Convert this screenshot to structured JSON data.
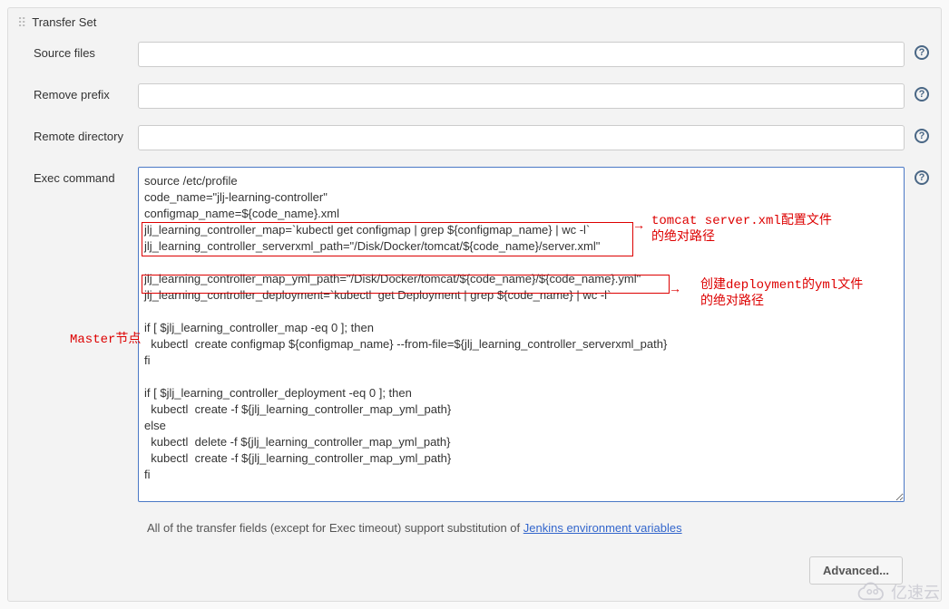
{
  "panel": {
    "title": "Transfer Set"
  },
  "fields": {
    "source_files": {
      "label": "Source files",
      "value": ""
    },
    "remove_prefix": {
      "label": "Remove prefix",
      "value": ""
    },
    "remote_directory": {
      "label": "Remote directory",
      "value": ""
    },
    "exec_command": {
      "label": "Exec command",
      "value": "source /etc/profile\ncode_name=\"jlj-learning-controller\"\nconfigmap_name=${code_name}.xml\njlj_learning_controller_map=`kubectl get configmap | grep ${configmap_name} | wc -l`\njlj_learning_controller_serverxml_path=\"/Disk/Docker/tomcat/${code_name}/server.xml\"\n\njlj_learning_controller_map_yml_path=\"/Disk/Docker/tomcat/${code_name}/${code_name}.yml\"\njlj_learning_controller_deployment=`kubectl  get Deployment | grep ${code_name} | wc -l`\n\nif [ $jlj_learning_controller_map -eq 0 ]; then\n  kubectl  create configmap ${configmap_name} --from-file=${jlj_learning_controller_serverxml_path}\nfi\n\nif [ $jlj_learning_controller_deployment -eq 0 ]; then\n  kubectl  create -f ${jlj_learning_controller_map_yml_path}\nelse\n  kubectl  delete -f ${jlj_learning_controller_map_yml_path}\n  kubectl  create -f ${jlj_learning_controller_map_yml_path}\nfi"
    }
  },
  "helper": {
    "prefix": "All of the transfer fields (except for Exec timeout) support substitution of ",
    "link": "Jenkins environment variables"
  },
  "buttons": {
    "advanced": "Advanced..."
  },
  "help_icon_glyph": "?",
  "annotations": {
    "master_node": "Master节点",
    "note1_line1": "tomcat server.xml配置文件",
    "note1_line2": "的绝对路径",
    "note2_line1": "创建deployment的yml文件",
    "note2_line2": "的绝对路径"
  },
  "watermark": "亿速云"
}
